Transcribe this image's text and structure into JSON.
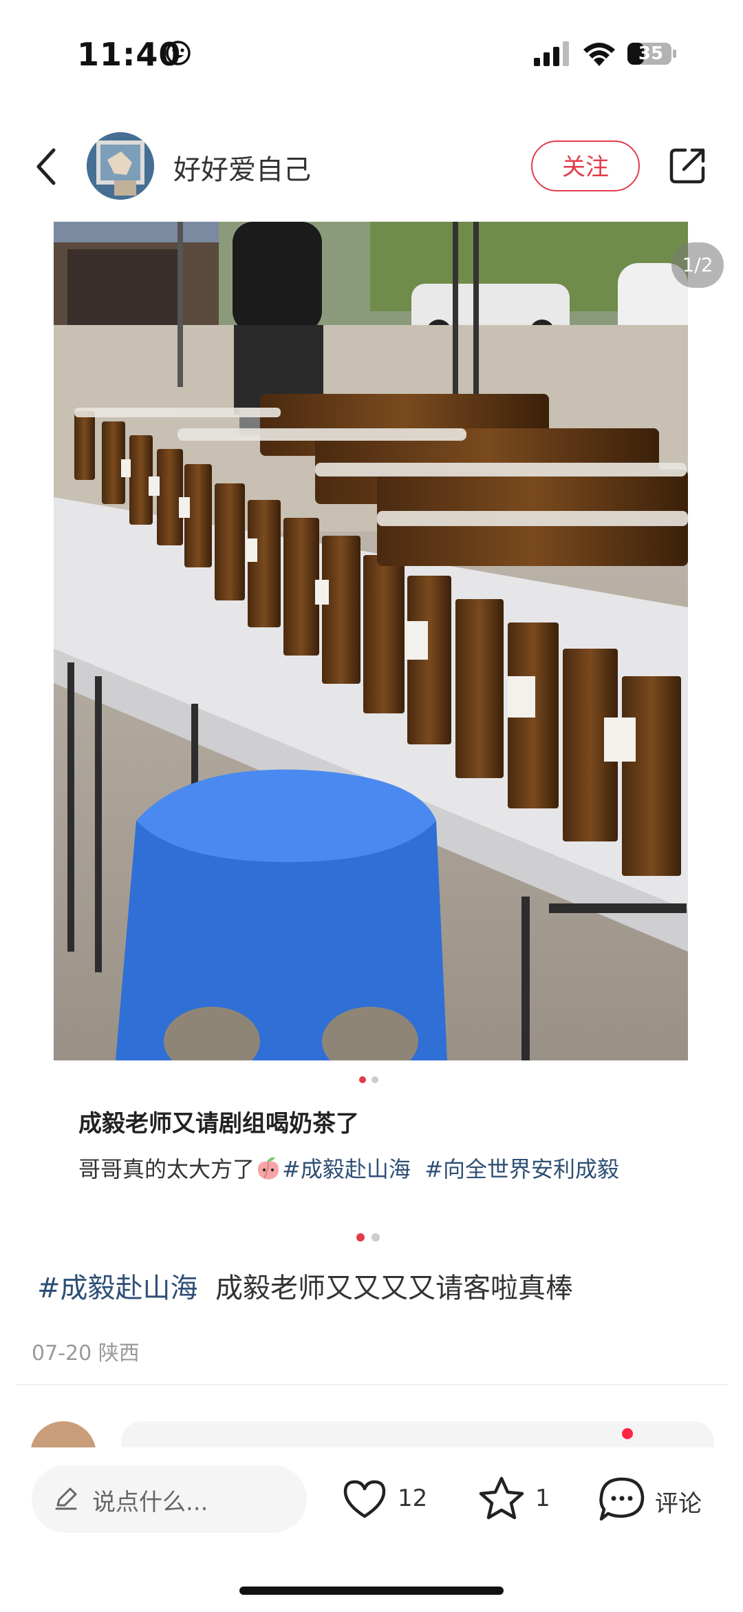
{
  "status_bar": {
    "time": "11:40",
    "battery": "35",
    "time_emoji_icon": "smiley-icon"
  },
  "header": {
    "username": "好好爱自己",
    "follow_label": "关注"
  },
  "photo": {
    "page_indicator": "1/2"
  },
  "post": {
    "title": "成毅老师又请剧组喝奶茶了",
    "body_text": "哥哥真的太大方了",
    "body_tags": [
      "#成毅赴山海",
      "#向全世界安利成毅"
    ]
  },
  "main_text": {
    "tag": "#成毅赴山海",
    "text": "成毅老师又又又又请客啦真棒"
  },
  "meta": {
    "date": "07-20",
    "location": "陕西"
  },
  "bottom_bar": {
    "input_placeholder": "说点什么...",
    "likes": "12",
    "stars": "1",
    "comment_label": "评论"
  },
  "colors": {
    "accent": "#e33b4a",
    "tag": "#2e4f74",
    "badge": "#ff2442"
  }
}
